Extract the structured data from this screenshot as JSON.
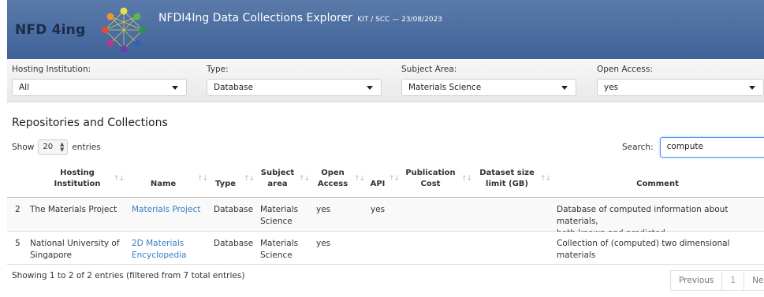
{
  "header": {
    "logo_text_prefix": "NFD",
    "logo_text_i": "i",
    "logo_text_suffix": "4ing",
    "title": "NFDI4Ing Data Collections Explorer",
    "subtitle": "KIT / SCC — 23/08/2023",
    "bg_color": "#4a6da3"
  },
  "filters": [
    {
      "label": "Hosting Institution:",
      "value": "All"
    },
    {
      "label": "Type:",
      "value": "Database"
    },
    {
      "label": "Subject Area:",
      "value": "Materials Science"
    },
    {
      "label": "Open Access:",
      "value": "yes"
    }
  ],
  "section_title": "Repositories and Collections",
  "length": {
    "show": "Show",
    "value": "20",
    "entries": "entries"
  },
  "search": {
    "label": "Search:",
    "value": "compute"
  },
  "columns": [
    {
      "l1": "Hosting",
      "l2": "Institution"
    },
    {
      "l1": "",
      "l2": "Name"
    },
    {
      "l1": "",
      "l2": "Type"
    },
    {
      "l1": "Subject",
      "l2": "area"
    },
    {
      "l1": "Open",
      "l2": "Access"
    },
    {
      "l1": "",
      "l2": "API"
    },
    {
      "l1": "Publication",
      "l2": "Cost"
    },
    {
      "l1": "Dataset size",
      "l2": "limit (GB)"
    },
    {
      "l1": "",
      "l2": "Comment"
    }
  ],
  "rows": [
    {
      "index": "2",
      "institution": [
        "The Materials Project",
        ""
      ],
      "name": [
        "Materials Project",
        ""
      ],
      "type": "Database",
      "subject": [
        "Materials",
        "Science"
      ],
      "open_access": "yes",
      "api": "yes",
      "cost": "",
      "size": "",
      "comment": [
        "Database of computed information about materials,",
        "both known and predicted."
      ]
    },
    {
      "index": "5",
      "institution": [
        "National University of",
        "Singapore"
      ],
      "name": [
        "2D Materials",
        "Encyclopedia"
      ],
      "type": "Database",
      "subject": [
        "Materials",
        "Science"
      ],
      "open_access": "yes",
      "api": "",
      "cost": "",
      "size": "",
      "comment": [
        "Collection of (computed) two dimensional materials",
        ""
      ]
    }
  ],
  "info": "Showing 1 to 2 of 2 entries (filtered from 7 total entries)",
  "pagination": {
    "previous": "Previous",
    "current": "1",
    "next": "Next"
  },
  "colors": {
    "link": "#3a7cc9",
    "header_top": "#5a7aaa",
    "header_bottom": "#3f6298"
  }
}
